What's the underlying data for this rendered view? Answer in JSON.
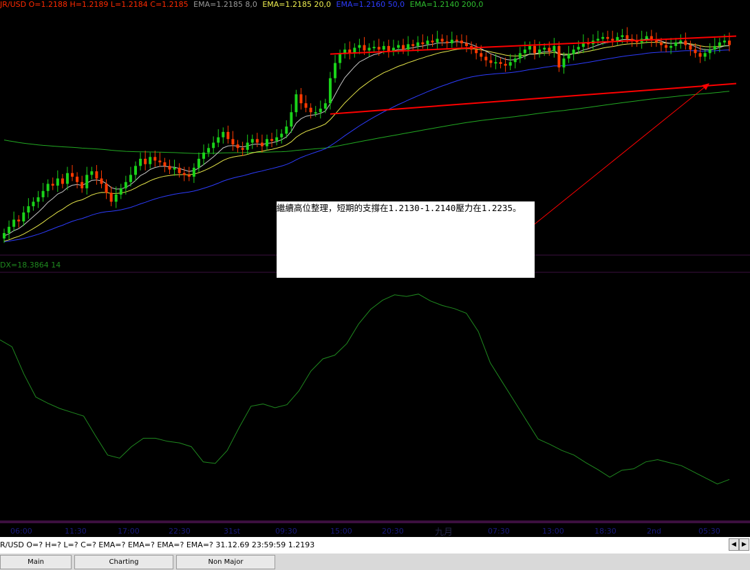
{
  "header": {
    "ohlc": "JR/USD O=1.2188 H=1.2189 L=1.2184 C=1.2185",
    "ema8": "EMA=1.2185  8,0",
    "ema20": "EMA=1.2185  20,0",
    "ema50": "EMA=1.2160  50,0",
    "ema200": "EMA=1.2140  200,0"
  },
  "colors": {
    "bull": "#1ad31a",
    "bear": "#ff3a00",
    "ema8": "#c8c8c8",
    "ema20": "#e8e84a",
    "ema50": "#2d3cff",
    "ema200": "#22aa22",
    "trend": "#ff0000",
    "indicator": "#1f8a1f",
    "ohlc_text": "#ff2a00"
  },
  "indicator": {
    "label": "DX=18.3864  14"
  },
  "note": {
    "text": "繼續高位整理，短期的支撐在1.2130-1.2140壓力在1.2235。"
  },
  "time_axis": {
    "ticks": [
      "06:00",
      "11:30",
      "17:00",
      "22:30",
      "31st",
      "09:30",
      "15:00",
      "20:30",
      "九月",
      "07:30",
      "13:00",
      "18:30",
      "2nd",
      "05:30"
    ]
  },
  "status_bar": {
    "text": "R/USD O=? H=? L=? C=?  EMA=? EMA=? EMA=? EMA=?  31.12.69 23:59:59 1.2193"
  },
  "tabs": [
    "Main",
    "Charting",
    "Non Major"
  ],
  "icons": {
    "left_arrow": "scroll-left-icon",
    "right_arrow": "scroll-right-icon"
  },
  "chart_data": {
    "type": "candlestick",
    "symbol": "EUR/USD",
    "ema_periods": [
      8,
      20,
      50,
      200
    ],
    "trend_channel": {
      "upper_start": 1.2205,
      "upper_end": 1.2225,
      "lower_start": 1.2138,
      "lower_end": 1.2172
    },
    "close_prices": [
      1.2005,
      1.2012,
      1.202,
      1.2018,
      1.2028,
      1.2035,
      1.204,
      1.2045,
      1.2052,
      1.206,
      1.2058,
      1.2066,
      1.206,
      1.2072,
      1.2068,
      1.2062,
      1.2055,
      1.207,
      1.2074,
      1.2066,
      1.206,
      1.205,
      1.204,
      1.2048,
      1.2055,
      1.2062,
      1.207,
      1.208,
      1.2088,
      1.2082,
      1.209,
      1.2086,
      1.2084,
      1.208,
      1.2076,
      1.2078,
      1.2072,
      1.207,
      1.2068,
      1.2078,
      1.2088,
      1.2095,
      1.21,
      1.2106,
      1.2112,
      1.2118,
      1.211,
      1.2104,
      1.21,
      1.2098,
      1.2106,
      1.211,
      1.2106,
      1.2102,
      1.211,
      1.2108,
      1.2112,
      1.2116,
      1.2124,
      1.214,
      1.216,
      1.215,
      1.2145,
      1.214,
      1.214,
      1.2144,
      1.215,
      1.2178,
      1.2195,
      1.2205,
      1.221,
      1.2206,
      1.2212,
      1.2215,
      1.2209,
      1.2212,
      1.2213,
      1.221,
      1.2214,
      1.2208,
      1.2212,
      1.2215,
      1.221,
      1.2216,
      1.2214,
      1.2218,
      1.2216,
      1.222,
      1.2218,
      1.2222,
      1.2219,
      1.2217,
      1.2221,
      1.222,
      1.2217,
      1.2214,
      1.221,
      1.2206,
      1.2202,
      1.2198,
      1.2195,
      1.2196,
      1.2194,
      1.2192,
      1.2196,
      1.22,
      1.2206,
      1.221,
      1.2214,
      1.2206,
      1.221,
      1.2212,
      1.2208,
      1.2214,
      1.219,
      1.22,
      1.2205,
      1.221,
      1.2213,
      1.2218,
      1.2216,
      1.222,
      1.2222,
      1.2224,
      1.2222,
      1.222,
      1.2224,
      1.2226,
      1.2222,
      1.222,
      1.2218,
      1.2222,
      1.2225,
      1.222,
      1.2218,
      1.2215,
      1.2212,
      1.2214,
      1.2218,
      1.222,
      1.2215,
      1.221,
      1.2206,
      1.2202,
      1.2206,
      1.221,
      1.2214,
      1.2218,
      1.222,
      1.2215
    ],
    "ema200_start": 1.211,
    "indicator_values": [
      23.5,
      22.6,
      19.0,
      16.0,
      15.2,
      14.5,
      14.0,
      13.5,
      10.9,
      8.4,
      8.0,
      9.5,
      10.6,
      10.6,
      10.2,
      10.0,
      9.5,
      7.5,
      7.3,
      9.0,
      12.0,
      14.8,
      15.1,
      14.6,
      15.0,
      16.8,
      19.4,
      21.0,
      21.5,
      23.0,
      25.6,
      27.5,
      28.7,
      29.4,
      29.2,
      29.5,
      28.6,
      28.0,
      27.6,
      27.0,
      24.6,
      20.5,
      18.0,
      15.5,
      13.0,
      10.5,
      9.8,
      9.0,
      8.4,
      7.4,
      6.5,
      5.5,
      6.4,
      6.6,
      7.5,
      7.8,
      7.4,
      7.0,
      6.2,
      5.4,
      4.6,
      5.2
    ]
  }
}
